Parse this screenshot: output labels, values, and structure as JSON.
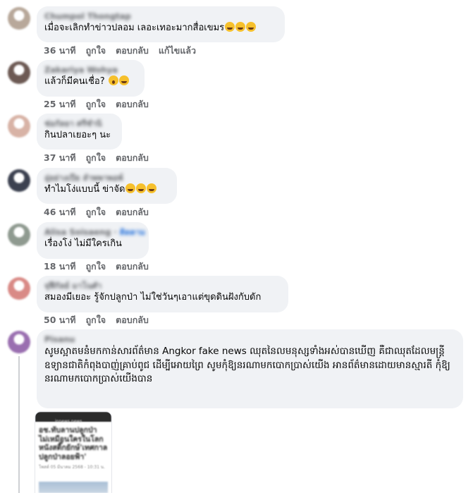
{
  "comments": [
    {
      "author": "Chumpol Thongtap",
      "text": "เมื่อจะเลิกทำข่าวปลอม เลอะเทอะมากสื่อเขมร",
      "emojis": [
        "rolling-on-floor-laughing",
        "rolling-on-floor-laughing",
        "rolling-on-floor-laughing"
      ],
      "time": "36 นาที",
      "like": "ถูกใจ",
      "reply": "ตอบกลับ",
      "edited": "แก้ไขแล้ว",
      "avatar_color": "#b8a89a"
    },
    {
      "author": "Zakariya Wohya",
      "text": "แล้วก็มีคนเชื่อ?",
      "emojis": [
        "shocked-face",
        "rolling-on-floor-laughing"
      ],
      "time": "25 นาที",
      "like": "ถูกใจ",
      "reply": "ตอบกลับ",
      "avatar_color": "#6d5a54"
    },
    {
      "author": "ช่อกัลยา ศรีชำนิ",
      "text": "กินปลาเยอะๆ นะ",
      "emojis": [],
      "time": "37 นาที",
      "like": "ถูกใจ",
      "reply": "ตอบกลับ",
      "avatar_color": "#d8b3a6"
    },
    {
      "author": "อุ่ยย่างเปีย ลำพพาพอพ์",
      "text": "ทำไมโง่แบบนี้ ข่าจัด",
      "emojis": [
        "rolling-on-floor-laughing",
        "rolling-on-floor-laughing",
        "rolling-on-floor-laughing"
      ],
      "time": "46 นาที",
      "like": "ถูกใจ",
      "reply": "ตอบกลับ",
      "avatar_color": "#3c4150"
    },
    {
      "author": "Alisa Soisaeng",
      "follow": "ติดตาม",
      "text": "เรื่องโง่ ไม่มีใครเกิน",
      "emojis": [],
      "time": "18 นาที",
      "like": "ถูกใจ",
      "reply": "ตอบกลับ",
      "avatar_color": "#8f9a90"
    },
    {
      "author": "จุฬีกัลย์ มาโนศํา",
      "text": "สมองมีเยอะ รู้จักปลูกป่า ไม่ใช่วันๆเอาแต่ขุดดินฝังกับดัก",
      "emojis": [],
      "time": "50 นาที",
      "like": "ถูกใจ",
      "reply": "ตอบกลับ",
      "avatar_color": "#d98a86"
    },
    {
      "author": "Pisanu",
      "text": "សូមស្អាតមនំមកកាន់សារព័ត៌មាន Angkor fake news ឈុតនៃលមនុស្សទាំងអស់បានឃើញ គឺជាឈុតដែលមន្ត្រីឧទ្យានជាតិកំពុងបាញ់គ្រាប់ពូជ ដើម្បីអោយព្រៃ សូមកុំឱ្យនរណាមកបោកប្រាស់យើង អានព័ត៌មានដោយមានស្មារតី កុំឱ្យនរណាមកបោកប្រាស់យើងបាន",
      "avatar_color": "#9a6fb0"
    }
  ],
  "attachment": {
    "site": "innews.news",
    "headline": "อช.ทับลานปลูกป่า ไม่เหมือนใครในโลก หนังสติ๊กยักษ์'เทศกาลปลูกป่าลอยฟ้า'",
    "meta": "โพสต์ 05 มีนาคม 2568 - 10:31 น."
  }
}
